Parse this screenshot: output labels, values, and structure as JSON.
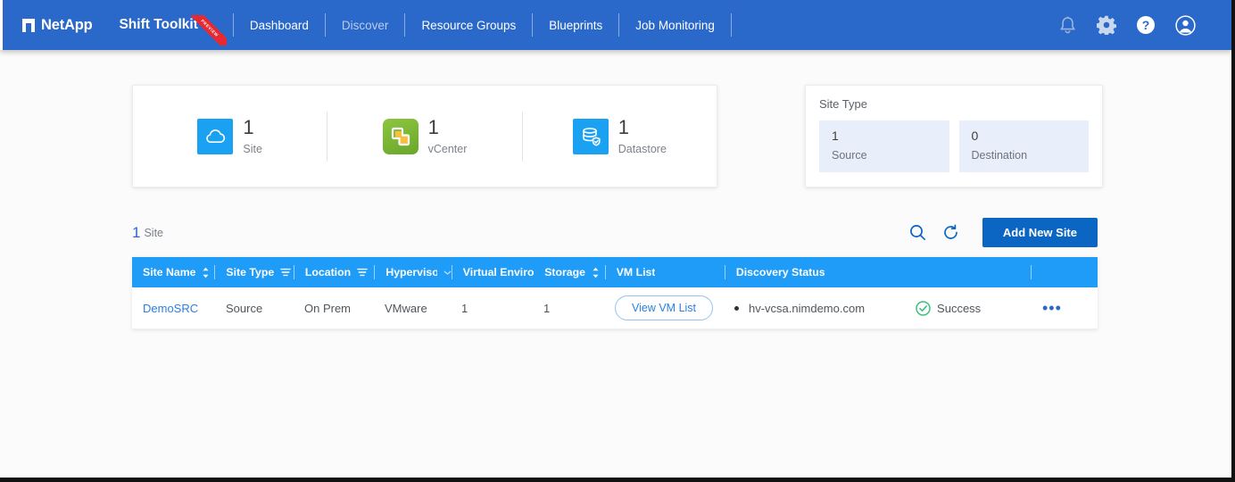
{
  "navbar": {
    "brand": "NetApp",
    "product": "Shift Toolkit",
    "ribbon": "PREVIEW",
    "links": [
      {
        "label": "Dashboard",
        "active": false
      },
      {
        "label": "Discover",
        "active": true
      },
      {
        "label": "Resource Groups",
        "active": false
      },
      {
        "label": "Blueprints",
        "active": false
      },
      {
        "label": "Job Monitoring",
        "active": false
      }
    ],
    "icons": [
      {
        "name": "bell-icon"
      },
      {
        "name": "gear-icon"
      },
      {
        "name": "help-icon"
      },
      {
        "name": "user-account-icon"
      }
    ],
    "accent_color": "#2a68ca"
  },
  "summary": {
    "stats": [
      {
        "icon": "cloud-icon",
        "value": "1",
        "label": "Site"
      },
      {
        "icon": "vcenter-icon",
        "value": "1",
        "label": "vCenter"
      },
      {
        "icon": "datastore-icon",
        "value": "1",
        "label": "Datastore"
      }
    ]
  },
  "site_type": {
    "title": "Site Type",
    "boxes": [
      {
        "value": "1",
        "label": "Source"
      },
      {
        "value": "0",
        "label": "Destination"
      }
    ]
  },
  "toolbar": {
    "count": "1",
    "count_label": "Site",
    "search_icon": "search-icon",
    "refresh_icon": "refresh-icon",
    "add_button": "Add New Site"
  },
  "table": {
    "columns": [
      {
        "label": "Site Name",
        "adorn": "sort"
      },
      {
        "label": "Site Type",
        "adorn": "filter"
      },
      {
        "label": "Location",
        "adorn": "filter"
      },
      {
        "label": "Hypervisor",
        "adorn": "caret"
      },
      {
        "label": "Virtual Environ",
        "adorn": "none"
      },
      {
        "label": "Storage",
        "adorn": "sort"
      },
      {
        "label": "VM List",
        "adorn": "none"
      },
      {
        "label": "Discovery Status",
        "adorn": "none"
      },
      {
        "label": "",
        "adorn": "none"
      }
    ],
    "rows": [
      {
        "site_name": "DemoSRC",
        "site_type": "Source",
        "location": "On Prem",
        "hypervisor": "VMware",
        "virtual_environment": "1",
        "storage": "1",
        "vm_list_button": "View VM List",
        "discovery_host": "hv-vcsa.nimdemo.com",
        "discovery_status": "Success",
        "actions_icon": "kebab-menu-icon"
      }
    ]
  },
  "colors": {
    "nav_blue": "#2a68ca",
    "table_header_blue": "#1f9cf7",
    "primary_button": "#0a66c2",
    "success_green": "#3fc07c",
    "link_blue": "#2a7fe0"
  }
}
